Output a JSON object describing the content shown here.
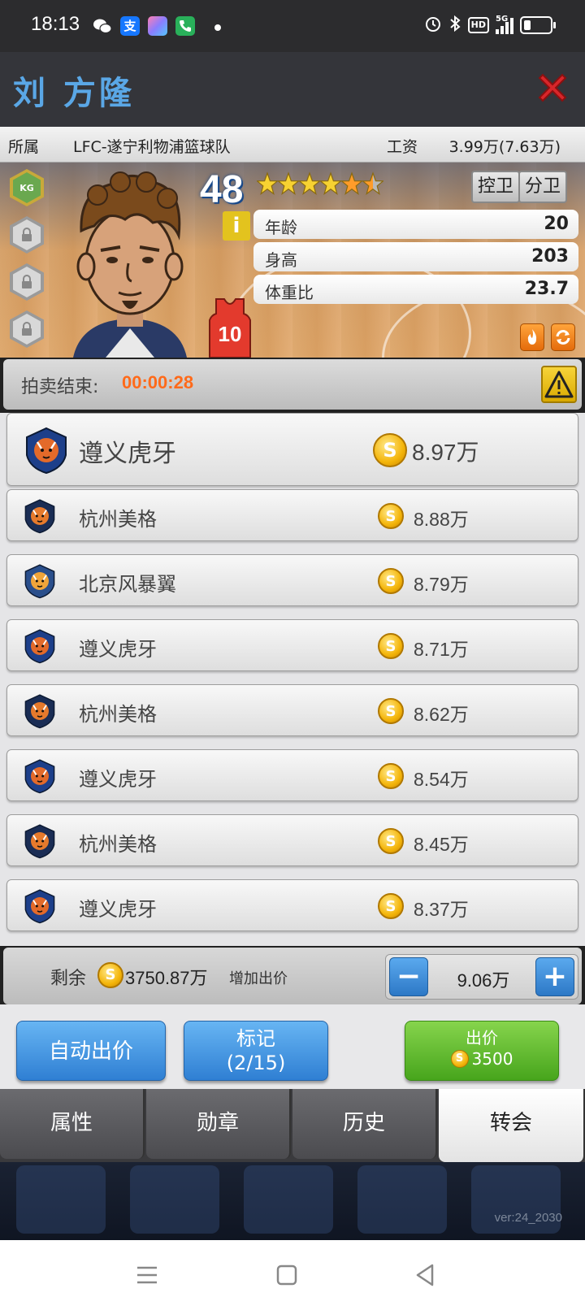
{
  "status_bar": {
    "time": "18:13",
    "apps": [
      "wechat-icon",
      "alipay-icon",
      "gallery-icon",
      "phone-icon"
    ],
    "alipay_glyph": "支",
    "hd_label": "HD",
    "network_label": "5G",
    "battery_level": 0.2
  },
  "title": {
    "player_name": "刘 方隆",
    "close_icon": "close-x-icon"
  },
  "info": {
    "team_label": "所属",
    "team_name": "LFC-遂宁利物浦篮球队",
    "salary_label": "工资",
    "salary_value": "3.99万(7.63万)"
  },
  "player": {
    "rating": "48",
    "stars": 5.5,
    "max_stars": 6,
    "jersey_number": "10",
    "kg_badge": "KG",
    "positions": [
      "控卫",
      "分卫"
    ],
    "info_icon": "i",
    "stats": [
      {
        "label": "年龄",
        "value": "20"
      },
      {
        "label": "身高",
        "value": "203"
      },
      {
        "label": "体重比",
        "value": "23.7"
      }
    ]
  },
  "auction": {
    "label": "拍卖结束:",
    "time_left": "00:00:28"
  },
  "bids": [
    {
      "team": "遵义虎牙",
      "amount": "8.97万",
      "logo": "tiger-shield"
    },
    {
      "team": "杭州美格",
      "amount": "8.88万",
      "logo": "tiger-badge"
    },
    {
      "team": "北京风暴翼",
      "amount": "8.79万",
      "logo": "wolf-badge"
    },
    {
      "team": "遵义虎牙",
      "amount": "8.71万",
      "logo": "tiger-shield"
    },
    {
      "team": "杭州美格",
      "amount": "8.62万",
      "logo": "tiger-badge"
    },
    {
      "team": "遵义虎牙",
      "amount": "8.54万",
      "logo": "tiger-shield"
    },
    {
      "team": "杭州美格",
      "amount": "8.45万",
      "logo": "tiger-badge"
    },
    {
      "team": "遵义虎牙",
      "amount": "8.37万",
      "logo": "tiger-shield"
    }
  ],
  "coin_glyph": "S",
  "balance": {
    "label": "剩余",
    "value": "3750.87万",
    "raise_label": "增加出价",
    "raise_value": "9.06万",
    "minus": "−",
    "plus": "+"
  },
  "actions": {
    "auto_bid": "自动出价",
    "mark_line1": "标记",
    "mark_line2": "(2/15)",
    "bid_label": "出价",
    "bid_cost": "3500"
  },
  "tabs": [
    {
      "label": "属性",
      "active": false
    },
    {
      "label": "勋章",
      "active": false
    },
    {
      "label": "历史",
      "active": false
    },
    {
      "label": "转会",
      "active": true
    }
  ],
  "version": "ver:24_2030",
  "colors": {
    "accent_blue": "#5aa7e6",
    "timer_orange": "#ff6a1a",
    "bid_green": "#47a51c",
    "close_red": "#d8262a"
  }
}
